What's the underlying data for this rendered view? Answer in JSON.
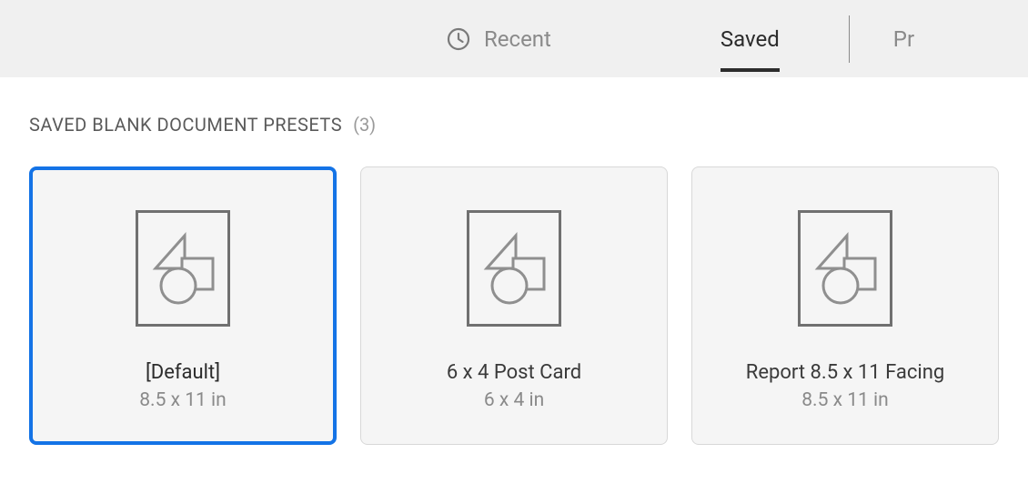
{
  "tabs": {
    "recent": {
      "label": "Recent"
    },
    "saved": {
      "label": "Saved"
    },
    "truncated": {
      "label": "Pr"
    }
  },
  "section": {
    "title": "SAVED BLANK DOCUMENT PRESETS",
    "count": "(3)"
  },
  "presets": [
    {
      "name": "[Default]",
      "dims": "8.5 x 11 in",
      "selected": true
    },
    {
      "name": "6 x 4 Post Card",
      "dims": "6 x 4 in",
      "selected": false
    },
    {
      "name": "Report 8.5 x 11 Facing",
      "dims": "8.5 x 11 in",
      "selected": false
    }
  ]
}
